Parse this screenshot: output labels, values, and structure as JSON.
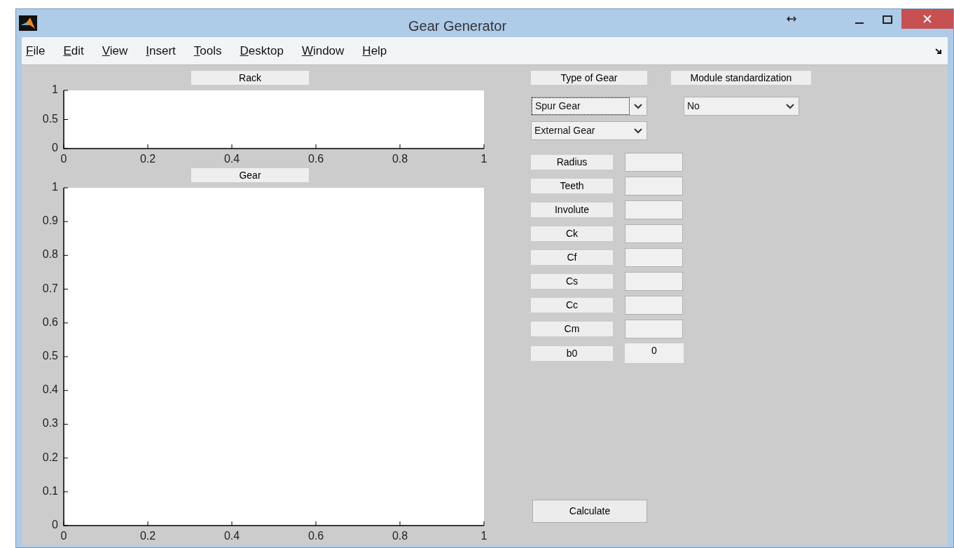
{
  "window": {
    "title": "Gear Generator"
  },
  "menu": [
    {
      "label": "File"
    },
    {
      "label": "Edit"
    },
    {
      "label": "View"
    },
    {
      "label": "Insert"
    },
    {
      "label": "Tools"
    },
    {
      "label": "Desktop"
    },
    {
      "label": "Window"
    },
    {
      "label": "Help"
    }
  ],
  "plots": [
    {
      "title": "Rack",
      "chart_data": {
        "type": "line",
        "xlim": [
          0,
          1
        ],
        "ylim": [
          0,
          1
        ],
        "xticks": [
          0,
          0.2,
          0.4,
          0.6,
          0.8,
          1
        ],
        "yticks": [
          0,
          0.5,
          1
        ]
      }
    },
    {
      "title": "Gear",
      "chart_data": {
        "type": "line",
        "xlim": [
          0,
          1
        ],
        "ylim": [
          0,
          1
        ],
        "xticks": [
          0,
          0.2,
          0.4,
          0.6,
          0.8,
          1
        ],
        "yticks": [
          0,
          0.1,
          0.2,
          0.3,
          0.4,
          0.5,
          0.6,
          0.7,
          0.8,
          0.9,
          1
        ]
      }
    }
  ],
  "type_of_gear": {
    "label": "Type of Gear",
    "dropdowns": [
      {
        "value": "Spur Gear",
        "focused": true
      },
      {
        "value": "External Gear",
        "focused": false
      }
    ]
  },
  "module_standardization": {
    "label": "Module standardization",
    "dropdown": {
      "value": "No",
      "focused": false
    }
  },
  "parameters": [
    {
      "label": "Radius"
    },
    {
      "label": "Teeth"
    },
    {
      "label": "Involute"
    },
    {
      "label": "Ck"
    },
    {
      "label": "Cf"
    },
    {
      "label": "Cs"
    },
    {
      "label": "Cc"
    },
    {
      "label": "Cm"
    },
    {
      "label": "b0",
      "value": "0"
    }
  ],
  "calculate_button": "Calculate"
}
